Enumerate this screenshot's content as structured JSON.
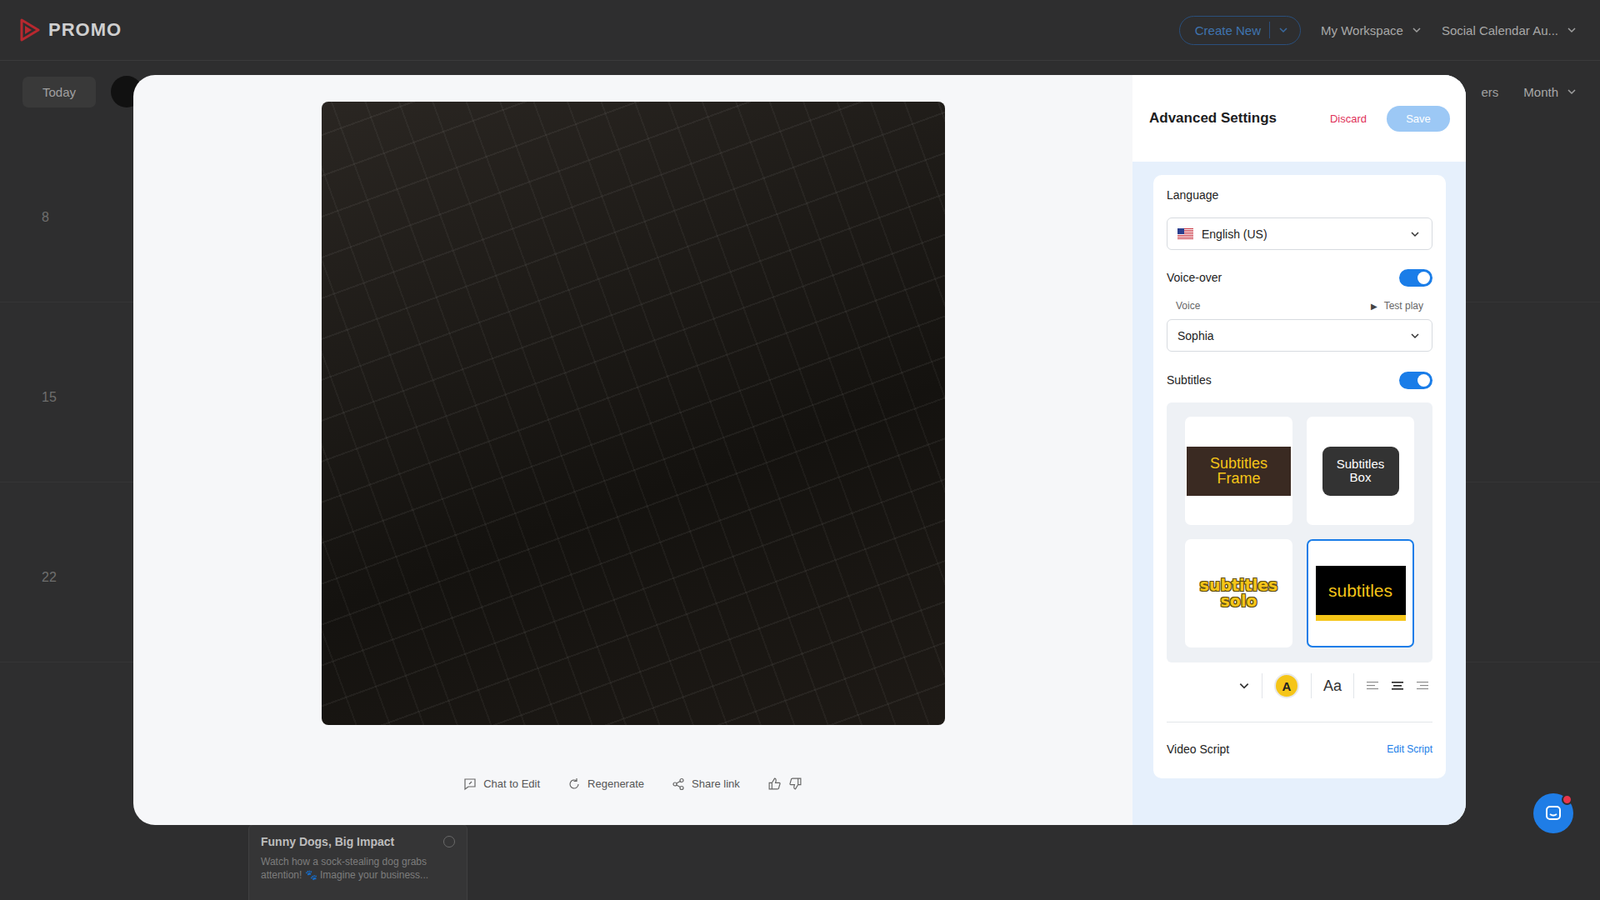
{
  "header": {
    "logo": "PROMO",
    "create_button": "Create New",
    "menus": [
      "My Workspace",
      "Social Calendar Au..."
    ]
  },
  "calendar_toolbar": {
    "today": "Today",
    "hidden_label": "ers",
    "view": "Month"
  },
  "calendar": {
    "week_days": [
      "8",
      "15",
      "22"
    ],
    "event": {
      "title": "Funny Dogs, Big Impact",
      "description": "Watch how a sock-stealing dog grabs attention! 🐾 Imagine your business..."
    }
  },
  "preview": {
    "actions": [
      "Chat to Edit",
      "Regenerate",
      "Share link"
    ]
  },
  "settings": {
    "title": "Advanced Settings",
    "discard": "Discard",
    "save": "Save",
    "save_disabled": true,
    "language": {
      "label": "Language",
      "value": "English (US)"
    },
    "voice_over": {
      "label": "Voice-over",
      "on": true
    },
    "voice": {
      "label": "Voice",
      "play_glyph": "▶",
      "test_play": "Test play",
      "value": "Sophia"
    },
    "subtitles": {
      "label": "Subtitles",
      "on": true,
      "styles": [
        {
          "label": "Subtitles Frame",
          "kind": "frame",
          "selected": false
        },
        {
          "label": "Subtitles Box",
          "kind": "box",
          "selected": false
        },
        {
          "label": "subtitles solo",
          "kind": "solo",
          "selected": false
        },
        {
          "label": "subtitles",
          "kind": "bar",
          "selected": true
        }
      ]
    },
    "format": {
      "color_glyph": "A",
      "font_glyph": "Aa",
      "align": [
        {
          "selected": false
        },
        {
          "selected": true
        },
        {
          "selected": false
        }
      ]
    },
    "script": {
      "label": "Video Script",
      "edit": "Edit Script"
    }
  },
  "chat_widget": {
    "unread": true
  }
}
